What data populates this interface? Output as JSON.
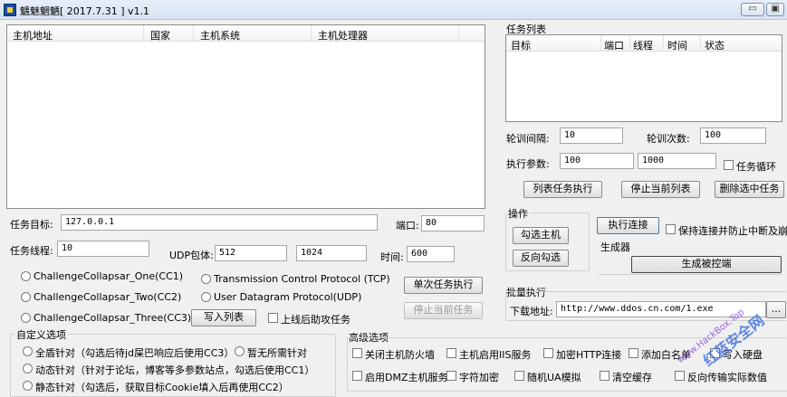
{
  "window": {
    "title": "魑魅魍魉[ 2017.7.31 ] v1.1",
    "min_label": "▭",
    "max_label": "▣"
  },
  "host_list": {
    "columns": [
      "主机地址",
      "国家",
      "主机系统",
      "主机处理器"
    ]
  },
  "task_list": {
    "title": "任务列表",
    "columns": [
      "目标",
      "端口",
      "线程",
      "时间",
      "状态"
    ]
  },
  "polling": {
    "interval_label": "轮训间隔:",
    "interval_value": "10",
    "count_label": "轮训次数:",
    "count_value": "100"
  },
  "exec_params": {
    "label": "执行参数:",
    "value1": "100",
    "value2": "1000",
    "loop_label": "任务循环"
  },
  "task_buttons": {
    "run_list": "列表任务执行",
    "stop_list": "停止当前列表",
    "delete_selected": "删除选中任务"
  },
  "target": {
    "label": "任务目标:",
    "value": "127.0.0.1",
    "port_label": "端口:",
    "port_value": "80"
  },
  "threads": {
    "label": "任务线程:",
    "value": "10",
    "udp_label": "UDP包体:",
    "udp_value1": "512",
    "udp_value2": "1024",
    "time_label": "时间:",
    "time_value": "600"
  },
  "protocols": {
    "cc1": "ChallengeCollapsar_One(CC1)",
    "cc2": "ChallengeCollapsar_Two(CC2)",
    "cc3": "ChallengeCollapsar_Three(CC3)",
    "tcp": "Transmission Control Protocol (TCP)",
    "udp": "User Datagram Protocol(UDP)"
  },
  "single_run": "单次任务执行",
  "stop_current": "停止当前任务",
  "write_list": "写入列表",
  "online_assist": "上线后助攻任务",
  "operate": {
    "title": "操作",
    "select_host": "勾选主机",
    "reverse_select": "反向勾选"
  },
  "connect": {
    "button": "执行连接",
    "keepalive_label": "保持连接并防止中断及崩溃"
  },
  "generator": {
    "title": "生成器",
    "button": "生成被控端"
  },
  "batch": {
    "title": "批量执行",
    "download_label": "下载地址:",
    "download_value": "http://www.ddos.cn.com/1.exe",
    "browse": "..."
  },
  "custom": {
    "title": "自定义选项",
    "opt1": "全盾针对（勾选后待jd屎巴响应后使用CC3）",
    "opt2": "暂无所需针对",
    "opt3": "动态针对（针对于论坛，博客等多参数站点，勾选后使用CC1）",
    "opt4": "静态针对（勾选后，获取目标Cookie填入后再使用CC2）"
  },
  "advanced": {
    "title": "高级选项",
    "items": [
      "关闭主机防火墙",
      "主机启用IIS服务",
      "加密HTTP连接",
      "添加白名单",
      "写入硬盘",
      "启用DMZ主机服务",
      "字符加密",
      "随机UA模拟",
      "清空缓存",
      "反向传输实际数值"
    ]
  },
  "watermark": {
    "text": "红蓝安全网",
    "sub": "www.HackBox.Top"
  }
}
